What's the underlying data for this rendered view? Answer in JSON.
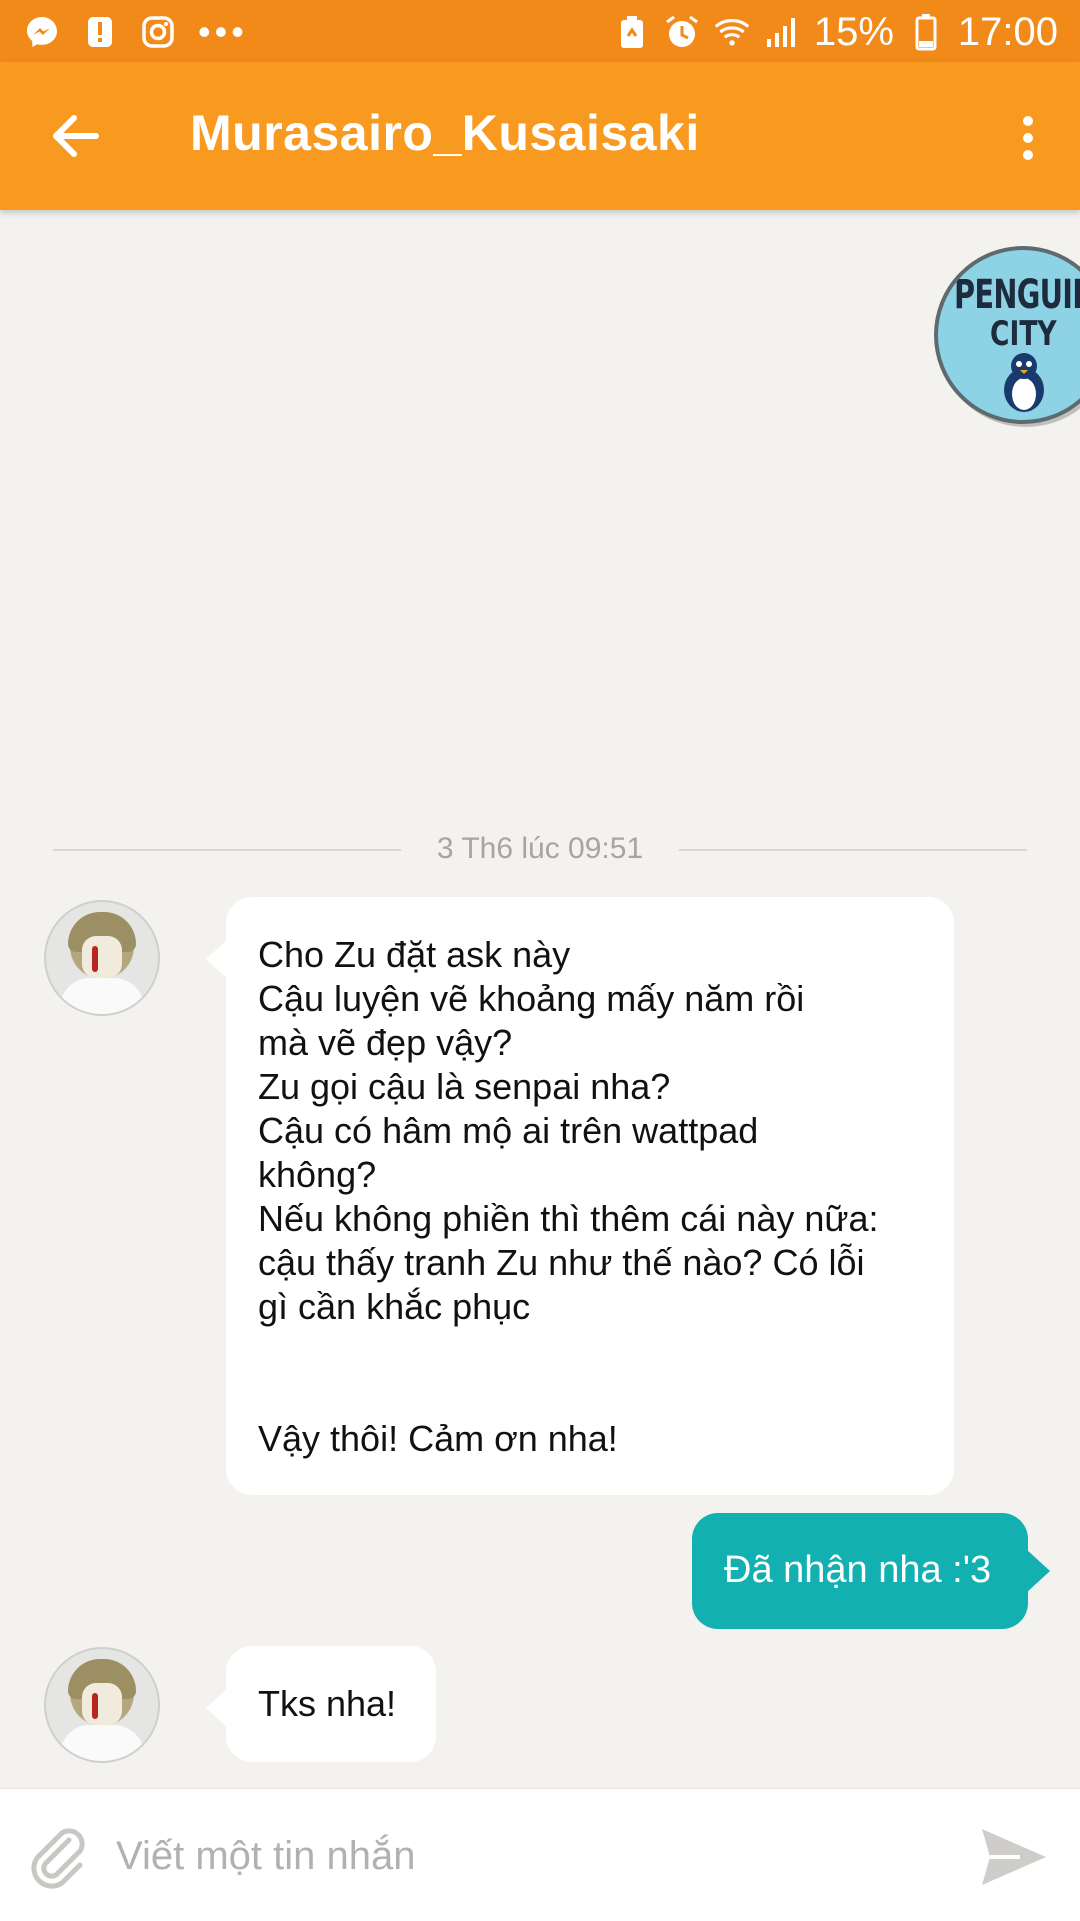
{
  "status_bar": {
    "battery_percent": "15%",
    "time": "17:00",
    "left_icons": [
      "messenger-icon",
      "alert-icon",
      "instagram-icon"
    ],
    "overflow": "•••"
  },
  "app_bar": {
    "title": "Murasairo_Kusaisaki",
    "color": "#f89920"
  },
  "sticker": {
    "line1": "PENGUIN",
    "line2": "CITY"
  },
  "conversation": {
    "date_separator": "3 Th6 lúc 09:51",
    "messages": [
      {
        "direction": "incoming",
        "text": "Cho Zu đặt ask này\nCậu luyện vẽ khoảng mấy năm rồi\nmà vẽ đẹp vậy?\nZu gọi cậu là senpai nha?\nCậu có hâm mộ ai trên wattpad\nkhông?\nNếu không phiền thì thêm cái này nữa:\ncậu thấy tranh Zu như thế nào? Có lỗi\ngì cần khắc phục\n\n\nVậy thôi! Cảm ơn nha!"
      },
      {
        "direction": "outgoing",
        "text": "Đã nhận nha :'3"
      },
      {
        "direction": "incoming",
        "text": "Tks nha!"
      }
    ]
  },
  "composer": {
    "placeholder": "Viết một tin nhắn",
    "value": ""
  },
  "colors": {
    "status_bar": "#f28a1a",
    "outgoing_bubble": "#12b0b0",
    "background": "#f3f2ef"
  }
}
